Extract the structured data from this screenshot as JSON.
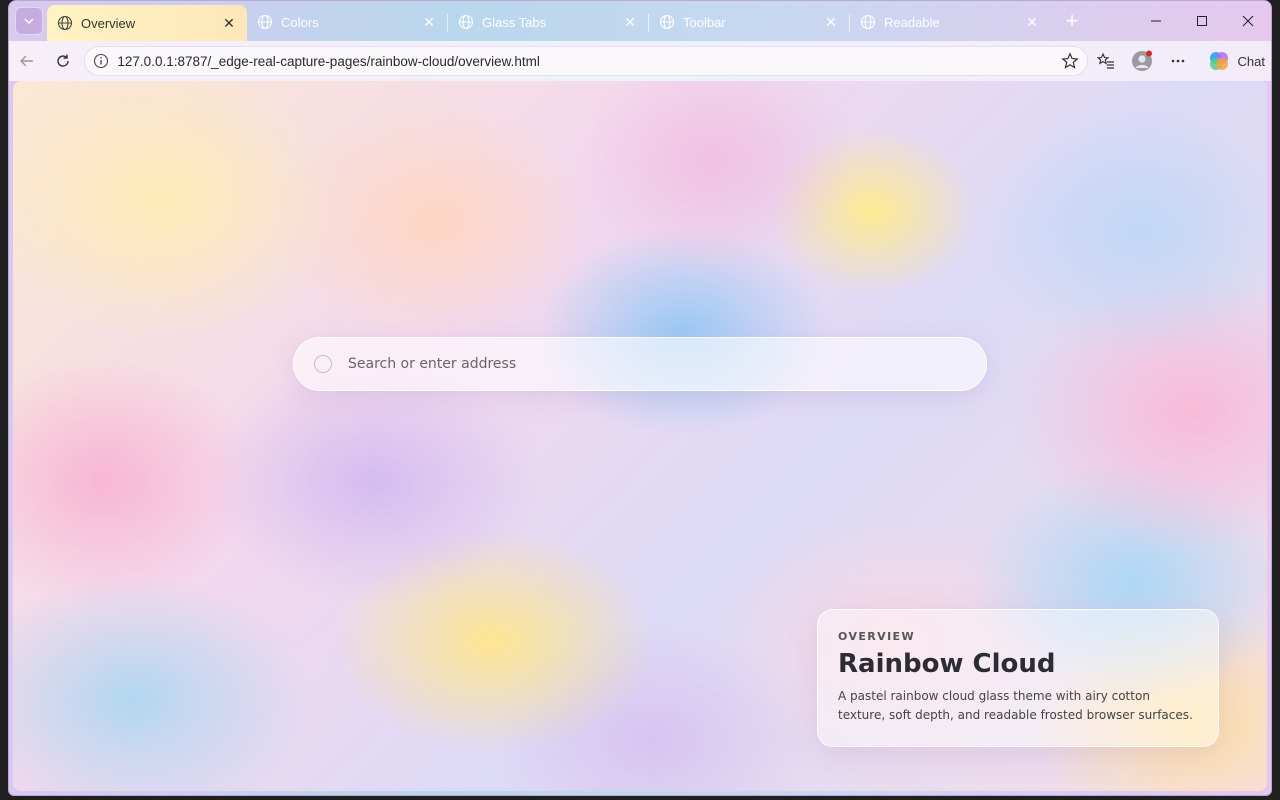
{
  "browser": {
    "tabs": [
      {
        "title": "Overview",
        "active": true
      },
      {
        "title": "Colors",
        "active": false
      },
      {
        "title": "Glass Tabs",
        "active": false
      },
      {
        "title": "Toolbar",
        "active": false
      },
      {
        "title": "Readable",
        "active": false
      }
    ],
    "address": "127.0.0.1:8787/_edge-real-capture-pages/rainbow-cloud/overview.html",
    "chat_label": "Chat"
  },
  "page": {
    "search_placeholder": "Search or enter address",
    "card": {
      "eyebrow": "OVERVIEW",
      "title": "Rainbow Cloud",
      "description": "A pastel rainbow cloud glass theme with airy cotton texture, soft depth, and readable frosted browser surfaces."
    }
  },
  "colors": {
    "active_tab": "#fff3c4",
    "tabstrip": "#b9d7ec",
    "toolbar": "#f3ecf8"
  }
}
